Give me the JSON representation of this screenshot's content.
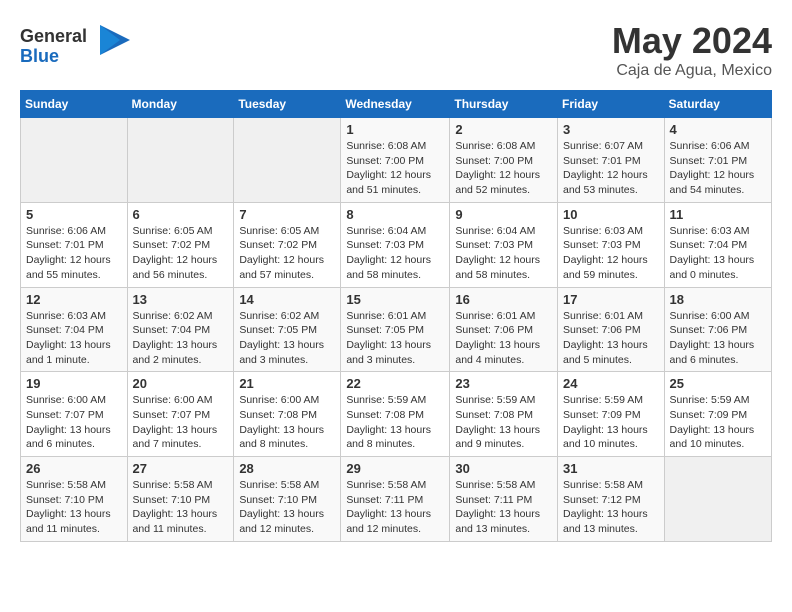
{
  "header": {
    "logo": {
      "general": "General",
      "blue": "Blue"
    },
    "title": "May 2024",
    "location": "Caja de Agua, Mexico"
  },
  "calendar": {
    "headers": [
      "Sunday",
      "Monday",
      "Tuesday",
      "Wednesday",
      "Thursday",
      "Friday",
      "Saturday"
    ],
    "rows": [
      [
        {
          "day": "",
          "info": ""
        },
        {
          "day": "",
          "info": ""
        },
        {
          "day": "",
          "info": ""
        },
        {
          "day": "1",
          "info": "Sunrise: 6:08 AM\nSunset: 7:00 PM\nDaylight: 12 hours\nand 51 minutes."
        },
        {
          "day": "2",
          "info": "Sunrise: 6:08 AM\nSunset: 7:00 PM\nDaylight: 12 hours\nand 52 minutes."
        },
        {
          "day": "3",
          "info": "Sunrise: 6:07 AM\nSunset: 7:01 PM\nDaylight: 12 hours\nand 53 minutes."
        },
        {
          "day": "4",
          "info": "Sunrise: 6:06 AM\nSunset: 7:01 PM\nDaylight: 12 hours\nand 54 minutes."
        }
      ],
      [
        {
          "day": "5",
          "info": "Sunrise: 6:06 AM\nSunset: 7:01 PM\nDaylight: 12 hours\nand 55 minutes."
        },
        {
          "day": "6",
          "info": "Sunrise: 6:05 AM\nSunset: 7:02 PM\nDaylight: 12 hours\nand 56 minutes."
        },
        {
          "day": "7",
          "info": "Sunrise: 6:05 AM\nSunset: 7:02 PM\nDaylight: 12 hours\nand 57 minutes."
        },
        {
          "day": "8",
          "info": "Sunrise: 6:04 AM\nSunset: 7:03 PM\nDaylight: 12 hours\nand 58 minutes."
        },
        {
          "day": "9",
          "info": "Sunrise: 6:04 AM\nSunset: 7:03 PM\nDaylight: 12 hours\nand 58 minutes."
        },
        {
          "day": "10",
          "info": "Sunrise: 6:03 AM\nSunset: 7:03 PM\nDaylight: 12 hours\nand 59 minutes."
        },
        {
          "day": "11",
          "info": "Sunrise: 6:03 AM\nSunset: 7:04 PM\nDaylight: 13 hours\nand 0 minutes."
        }
      ],
      [
        {
          "day": "12",
          "info": "Sunrise: 6:03 AM\nSunset: 7:04 PM\nDaylight: 13 hours\nand 1 minute."
        },
        {
          "day": "13",
          "info": "Sunrise: 6:02 AM\nSunset: 7:04 PM\nDaylight: 13 hours\nand 2 minutes."
        },
        {
          "day": "14",
          "info": "Sunrise: 6:02 AM\nSunset: 7:05 PM\nDaylight: 13 hours\nand 3 minutes."
        },
        {
          "day": "15",
          "info": "Sunrise: 6:01 AM\nSunset: 7:05 PM\nDaylight: 13 hours\nand 3 minutes."
        },
        {
          "day": "16",
          "info": "Sunrise: 6:01 AM\nSunset: 7:06 PM\nDaylight: 13 hours\nand 4 minutes."
        },
        {
          "day": "17",
          "info": "Sunrise: 6:01 AM\nSunset: 7:06 PM\nDaylight: 13 hours\nand 5 minutes."
        },
        {
          "day": "18",
          "info": "Sunrise: 6:00 AM\nSunset: 7:06 PM\nDaylight: 13 hours\nand 6 minutes."
        }
      ],
      [
        {
          "day": "19",
          "info": "Sunrise: 6:00 AM\nSunset: 7:07 PM\nDaylight: 13 hours\nand 6 minutes."
        },
        {
          "day": "20",
          "info": "Sunrise: 6:00 AM\nSunset: 7:07 PM\nDaylight: 13 hours\nand 7 minutes."
        },
        {
          "day": "21",
          "info": "Sunrise: 6:00 AM\nSunset: 7:08 PM\nDaylight: 13 hours\nand 8 minutes."
        },
        {
          "day": "22",
          "info": "Sunrise: 5:59 AM\nSunset: 7:08 PM\nDaylight: 13 hours\nand 8 minutes."
        },
        {
          "day": "23",
          "info": "Sunrise: 5:59 AM\nSunset: 7:08 PM\nDaylight: 13 hours\nand 9 minutes."
        },
        {
          "day": "24",
          "info": "Sunrise: 5:59 AM\nSunset: 7:09 PM\nDaylight: 13 hours\nand 10 minutes."
        },
        {
          "day": "25",
          "info": "Sunrise: 5:59 AM\nSunset: 7:09 PM\nDaylight: 13 hours\nand 10 minutes."
        }
      ],
      [
        {
          "day": "26",
          "info": "Sunrise: 5:58 AM\nSunset: 7:10 PM\nDaylight: 13 hours\nand 11 minutes."
        },
        {
          "day": "27",
          "info": "Sunrise: 5:58 AM\nSunset: 7:10 PM\nDaylight: 13 hours\nand 11 minutes."
        },
        {
          "day": "28",
          "info": "Sunrise: 5:58 AM\nSunset: 7:10 PM\nDaylight: 13 hours\nand 12 minutes."
        },
        {
          "day": "29",
          "info": "Sunrise: 5:58 AM\nSunset: 7:11 PM\nDaylight: 13 hours\nand 12 minutes."
        },
        {
          "day": "30",
          "info": "Sunrise: 5:58 AM\nSunset: 7:11 PM\nDaylight: 13 hours\nand 13 minutes."
        },
        {
          "day": "31",
          "info": "Sunrise: 5:58 AM\nSunset: 7:12 PM\nDaylight: 13 hours\nand 13 minutes."
        },
        {
          "day": "",
          "info": ""
        }
      ]
    ]
  }
}
